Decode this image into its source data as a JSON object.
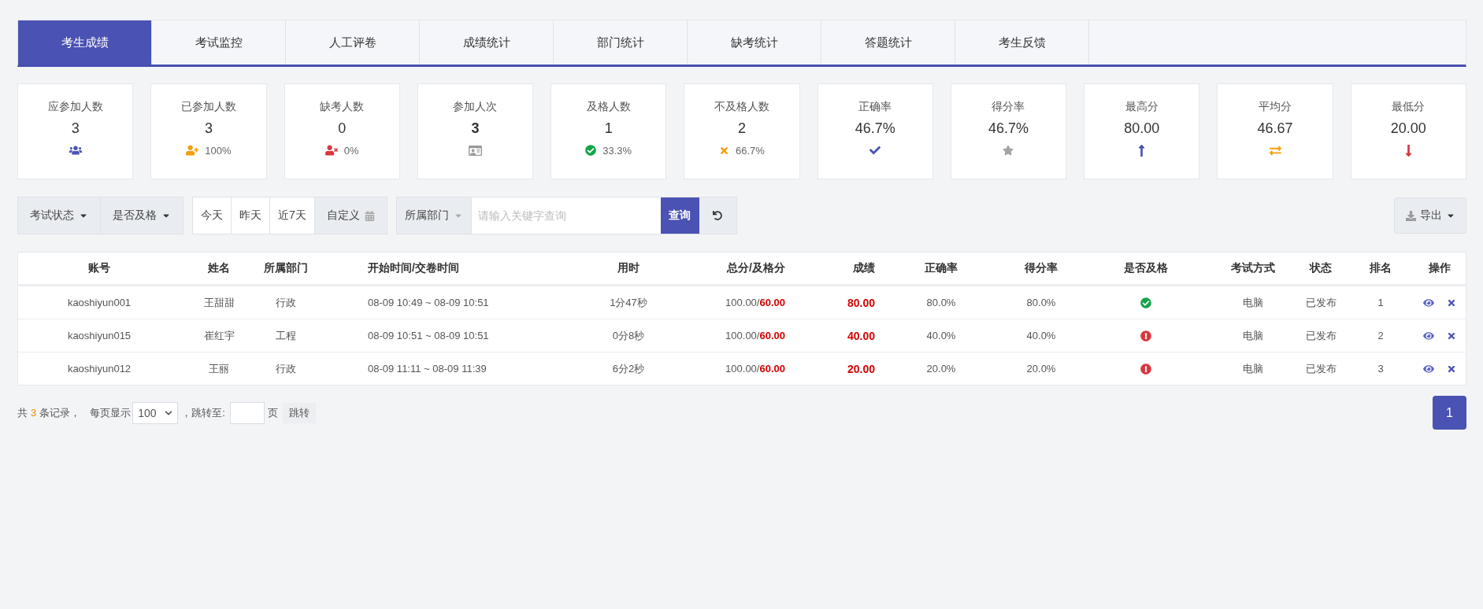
{
  "tabs": [
    {
      "label": "考生成绩",
      "selected": true
    },
    {
      "label": "考试监控",
      "selected": false
    },
    {
      "label": "人工评卷",
      "selected": false
    },
    {
      "label": "成绩统计",
      "selected": false
    },
    {
      "label": "部门统计",
      "selected": false
    },
    {
      "label": "缺考统计",
      "selected": false
    },
    {
      "label": "答题统计",
      "selected": false
    },
    {
      "label": "考生反馈",
      "selected": false
    }
  ],
  "stats": [
    {
      "label": "应参加人数",
      "value": "3",
      "kind": "group"
    },
    {
      "label": "已参加人数",
      "value": "3",
      "kind": "user-plus",
      "sub": "100%"
    },
    {
      "label": "缺考人数",
      "value": "0",
      "kind": "user-x",
      "sub": "0%"
    },
    {
      "label": "参加人次",
      "value": "3",
      "kind": "id-card",
      "bold": true
    },
    {
      "label": "及格人数",
      "value": "1",
      "kind": "check-circle",
      "sub": "33.3%"
    },
    {
      "label": "不及格人数",
      "value": "2",
      "kind": "cross",
      "sub": "66.7%"
    },
    {
      "label": "正确率",
      "value": "46.7%",
      "kind": "check"
    },
    {
      "label": "得分率",
      "value": "46.7%",
      "kind": "star"
    },
    {
      "label": "最高分",
      "value": "80.00",
      "kind": "up"
    },
    {
      "label": "平均分",
      "value": "46.67",
      "kind": "swap"
    },
    {
      "label": "最低分",
      "value": "20.00",
      "kind": "down"
    }
  ],
  "toolbar": {
    "filters": [
      "考试状态",
      "是否及格"
    ],
    "dates": [
      {
        "label": "今天",
        "kind": "preset"
      },
      {
        "label": "昨天",
        "kind": "preset"
      },
      {
        "label": "近7天",
        "kind": "preset"
      },
      {
        "label": "自定义",
        "kind": "custom"
      }
    ],
    "department": "所属部门",
    "search": {
      "placeholder": "请输入关键字查询"
    },
    "search_button": "查询",
    "export": "导出"
  },
  "table": {
    "columns": [
      "账号",
      "姓名",
      "所属部门",
      "开始时间/交卷时间",
      "用时",
      "总分/及格分",
      "成绩",
      "正确率",
      "得分率",
      "是否及格",
      "考试方式",
      "状态",
      "排名",
      "操作"
    ],
    "rows": [
      {
        "account": "kaoshiyun001",
        "name": "王甜甜",
        "dept": "行政",
        "time": "08-09 10:49 ~ 08-09 10:51",
        "duration": "1分47秒",
        "total": "100.00/",
        "pass_mark": "60.00",
        "score": "80.00",
        "correct": "80.0%",
        "rate": "80.0%",
        "passed": true,
        "method": "电脑",
        "status": "已发布",
        "rank": "1"
      },
      {
        "account": "kaoshiyun015",
        "name": "崔红宇",
        "dept": "工程",
        "time": "08-09 10:51 ~ 08-09 10:51",
        "duration": "0分8秒",
        "total": "100.00/",
        "pass_mark": "60.00",
        "score": "40.00",
        "correct": "40.0%",
        "rate": "40.0%",
        "passed": false,
        "method": "电脑",
        "status": "已发布",
        "rank": "2"
      },
      {
        "account": "kaoshiyun012",
        "name": "王丽",
        "dept": "行政",
        "time": "08-09 11:11 ~ 08-09 11:39",
        "duration": "6分2秒",
        "total": "100.00/",
        "pass_mark": "60.00",
        "score": "20.00",
        "correct": "20.0%",
        "rate": "20.0%",
        "passed": false,
        "method": "电脑",
        "status": "已发布",
        "rank": "3"
      }
    ]
  },
  "footer": {
    "total_prefix": "共",
    "total": "3",
    "total_suffix": "条记录，",
    "per_page_label": "每页显示",
    "per_page": "100",
    "jump_label": "，跳转至:",
    "page_unit": "页",
    "jump_button": "跳转",
    "pages": [
      {
        "label": "1",
        "selected": true
      }
    ]
  }
}
